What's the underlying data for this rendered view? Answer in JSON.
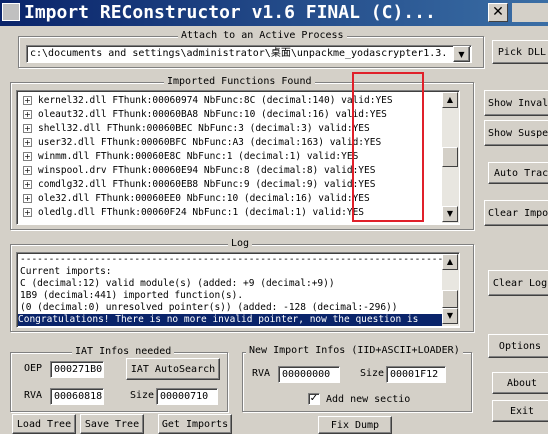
{
  "window": {
    "title": "Import REConstructor v1.6 FINAL (C)...",
    "close_glyph": "✕"
  },
  "attach": {
    "legend": "Attach to an Active Process",
    "process_path": "c:\\documents and settings\\administrator\\桌面\\unpackme_yodascrypter1.3.",
    "pick_dll_label": "Pick DLL"
  },
  "imports": {
    "legend": "Imported Functions Found",
    "rows": [
      "kernel32.dll FThunk:00060974 NbFunc:8C (decimal:140) valid:YES",
      "oleaut32.dll FThunk:00060BA8 NbFunc:10 (decimal:16) valid:YES",
      "shell32.dll FThunk:00060BEC NbFunc:3 (decimal:3) valid:YES",
      "user32.dll FThunk:00060BFC NbFunc:A3 (decimal:163) valid:YES",
      "winmm.dll FThunk:00060E8C NbFunc:1 (decimal:1) valid:YES",
      "winspool.drv FThunk:00060E94 NbFunc:8 (decimal:8) valid:YES",
      "comdlg32.dll FThunk:00060EB8 NbFunc:9 (decimal:9) valid:YES",
      "ole32.dll FThunk:00060EE0 NbFunc:10 (decimal:16) valid:YES",
      "oledlg.dll FThunk:00060F24 NbFunc:1 (decimal:1) valid:YES"
    ]
  },
  "side_buttons": {
    "show_invalid": "Show Inval",
    "show_suspect": "Show Suspe",
    "auto_trace": "Auto Trac",
    "clear_imports": "Clear Impor",
    "clear_log": "Clear Log",
    "options": "Options",
    "about": "About",
    "exit": "Exit"
  },
  "log": {
    "legend": "Log",
    "lines": [
      "--------------------------------------------------------------------------",
      "Current imports:",
      "C (decimal:12) valid module(s) (added: +9 (decimal:+9))",
      "1B9 (decimal:441) imported function(s).",
      "(0 (decimal:0) unresolved pointer(s)) (added: -128 (decimal:-296))",
      "Congratulations! There is no more invalid pointer, now the question is"
    ]
  },
  "iat": {
    "legend": "IAT Infos needed",
    "oep_label": "OEP",
    "oep_value": "000271B0",
    "autosearch_label": "IAT AutoSearch",
    "rva_label": "RVA",
    "rva_value": "00060818",
    "size_label": "Size",
    "size_value": "00000710"
  },
  "new_import": {
    "legend": "New Import Infos (IID+ASCII+LOADER)",
    "rva_label": "RVA",
    "rva_value": "00000000",
    "size_label": "Size",
    "size_value": "00001F12",
    "add_section_label": "Add new sectio",
    "add_section_checked": "✓"
  },
  "bottom_buttons": {
    "load_tree": "Load Tree",
    "save_tree": "Save Tree",
    "get_imports": "Get Imports",
    "fix_dump": "Fix Dump"
  },
  "icons": {
    "expand": "+",
    "dropdown": "▼",
    "scroll_up": "▲",
    "scroll_down": "▼"
  },
  "colors": {
    "highlight": "#0a246a",
    "annotation_red": "#e0202a"
  }
}
